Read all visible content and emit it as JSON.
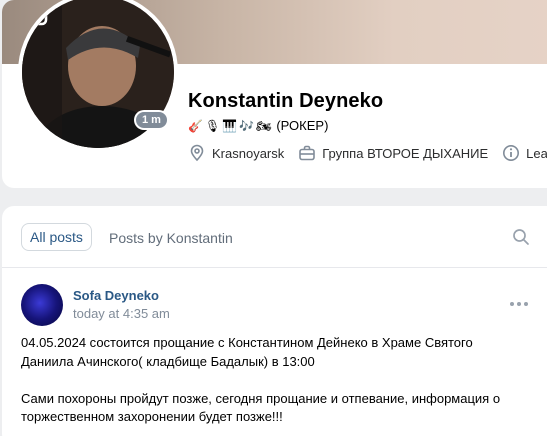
{
  "profile": {
    "name": "Konstantin Deyneko",
    "status_emoji": [
      "🎸",
      "🎙",
      "🎹",
      "🎶",
      "🏍"
    ],
    "status_text": "(РОКЕР)",
    "online_badge": "1 m",
    "city": "Krasnoyarsk",
    "group": "Группа ВТОРОЕ ДЫХАНИЕ",
    "learn_more": "Learn m",
    "icons": [
      "lock-icon",
      "location-pin-icon",
      "briefcase-icon",
      "info-icon"
    ]
  },
  "wall": {
    "tabs": [
      {
        "label": "All posts",
        "active": true
      },
      {
        "label": "Posts by Konstantin",
        "active": false
      }
    ]
  },
  "post": {
    "author": "Sofa Deyneko",
    "time": "today at 4:35 am",
    "paragraphs": [
      "04.05.2024 состоится прощание с Константином Дейнеко в Храме Святого Даниила Ачинского( кладбище Бадалык) в 13:00",
      "Сами похороны пройдут позже, сегодня прощание и отпевание, информация о торжественном захоронении будет позже!!!"
    ]
  },
  "colors": {
    "link": "#2a5885",
    "secondary_text": "#818c99",
    "background": "#edeef0"
  }
}
